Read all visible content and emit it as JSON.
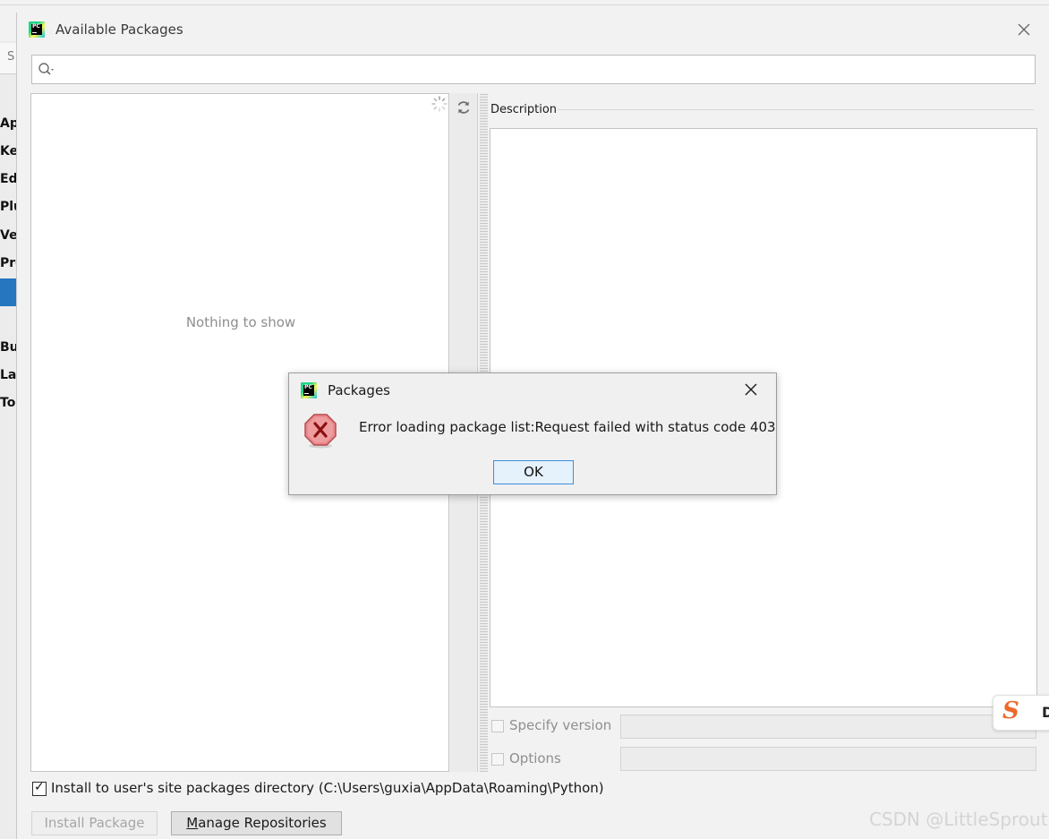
{
  "background_window": {
    "search_letter": "S",
    "items": [
      "Ap",
      "Ke",
      "Ed",
      "Plu",
      "Ve",
      "Pro",
      "Bu",
      "La",
      "To"
    ]
  },
  "dialog": {
    "title": "Available Packages",
    "close_icon": "close-icon",
    "search": {
      "value": "",
      "icon": "search-icon"
    },
    "list": {
      "empty_text": "Nothing to show"
    },
    "description_label": "Description",
    "specify_version_label": "Specify version",
    "options_label": "Options",
    "install_user_site_label": "Install to user's site packages directory (C:\\Users\\guxia\\AppData\\Roaming\\Python)",
    "install_user_site_checked": true,
    "install_button": "Install Package",
    "manage_button": "Manage Repositories",
    "manage_button_mnemonic": "M",
    "manage_button_rest": "anage Repositories"
  },
  "error_modal": {
    "title": "Packages",
    "message": "Error loading package list:Request failed with status code 403",
    "ok_button": "OK",
    "icon": "error-icon"
  },
  "overlay": {
    "watermark": "CSDN @LittleSprout",
    "widget_letter": "S",
    "widget_letter2": "D"
  },
  "colors": {
    "accent": "#2675bf",
    "error_red": "#e0575b",
    "ok_border": "#3c8fdc"
  }
}
